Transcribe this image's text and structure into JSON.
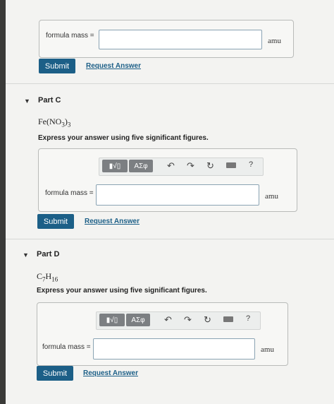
{
  "part_b": {
    "field_label": "formula mass =",
    "field_value": "",
    "unit": "amu",
    "submit_label": "Submit",
    "request_label": "Request Answer"
  },
  "part_c": {
    "caret": "▼",
    "title": "Part C",
    "formula_main": "Fe(NO",
    "formula_sub1": "3",
    "formula_close": ")",
    "formula_sub2": "3",
    "instruction": "Express your answer using five significant figures.",
    "toolbar": {
      "templates_label": "▮√▯",
      "symbols_label": "ΑΣφ",
      "help_label": "?"
    },
    "field_label": "formula mass =",
    "field_value": "",
    "unit": "amu",
    "submit_label": "Submit",
    "request_label": "Request Answer"
  },
  "part_d": {
    "caret": "▼",
    "title": "Part D",
    "formula_c": "C",
    "formula_c_sub": "7",
    "formula_h": "H",
    "formula_h_sub": "16",
    "instruction": "Express your answer using five significant figures.",
    "toolbar": {
      "templates_label": "▮√▯",
      "symbols_label": "ΑΣφ",
      "help_label": "?"
    },
    "field_label": "formula mass =",
    "field_value": "",
    "unit": "amu",
    "submit_label": "Submit",
    "request_label": "Request Answer"
  },
  "colors": {
    "accent": "#1c5f87",
    "toolbar_group": "#7c7f82"
  },
  "icons": [
    "undo-icon",
    "redo-icon",
    "reset-icon",
    "keyboard-icon",
    "help-icon"
  ]
}
